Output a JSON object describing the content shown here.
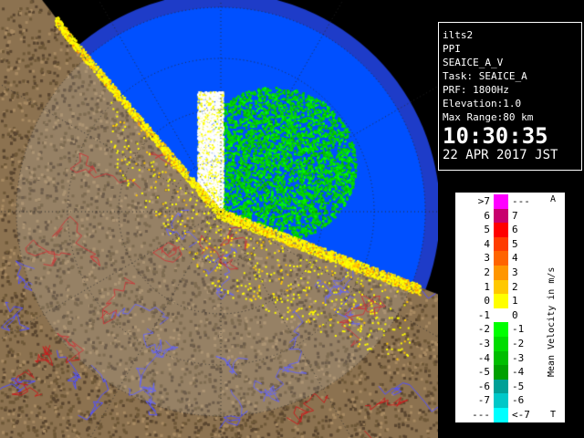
{
  "info": {
    "site": "ilts2",
    "scan_type": "PPI",
    "product": "SEAICE_A_V",
    "task": "Task: SEAICE_A",
    "prf": "PRF: 1800Hz",
    "elevation": "Elevation:1.0",
    "max_range": "Max Range:80 km",
    "time": "10:30:35",
    "date": "22 APR 2017 JST"
  },
  "legend": {
    "title": "Mean Velocity in m/s",
    "top_mark": "A",
    "bottom_mark": "T",
    "rows": [
      {
        "left": ">7",
        "right": "---",
        "color": "#ff00ff"
      },
      {
        "left": "6",
        "right": "7",
        "color": "#c8006e"
      },
      {
        "left": "5",
        "right": "6",
        "color": "#ff0000"
      },
      {
        "left": "4",
        "right": "5",
        "color": "#ff3c00"
      },
      {
        "left": "3",
        "right": "4",
        "color": "#ff6400"
      },
      {
        "left": "2",
        "right": "3",
        "color": "#ff9600"
      },
      {
        "left": "1",
        "right": "2",
        "color": "#ffc800"
      },
      {
        "left": "0",
        "right": "1",
        "color": "#ffff00"
      },
      {
        "left": "-1",
        "right": "0",
        "color": "#ffffff"
      },
      {
        "left": "-2",
        "right": "-1",
        "color": "#00ff00"
      },
      {
        "left": "-3",
        "right": "-2",
        "color": "#00dc00"
      },
      {
        "left": "-4",
        "right": "-3",
        "color": "#00be00"
      },
      {
        "left": "-5",
        "right": "-4",
        "color": "#00a000"
      },
      {
        "left": "-6",
        "right": "-5",
        "color": "#00a096"
      },
      {
        "left": "-7",
        "right": "-6",
        "color": "#00c8c8"
      },
      {
        "left": "---",
        "right": "<-7",
        "color": "#00ffff"
      }
    ]
  },
  "map_colors": {
    "sea": "#0050ff",
    "sea_outside": "#1e3cc8",
    "land": "#8c7250",
    "river": "#5050ff",
    "boundary": "#c81e1e"
  }
}
